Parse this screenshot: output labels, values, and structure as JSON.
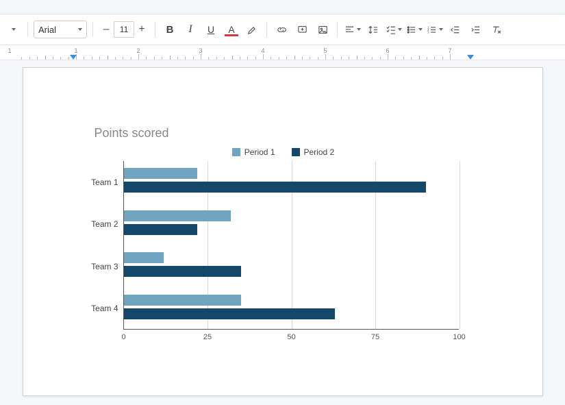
{
  "toolbar": {
    "font_name": "Arial",
    "font_size": "11",
    "btn_dec": "–",
    "btn_inc": "+",
    "bold": "B",
    "italic": "I",
    "underline": "U",
    "textcolor": "A"
  },
  "ruler": {
    "nums": [
      "1",
      "1",
      "2",
      "3",
      "4",
      "5",
      "6",
      "7"
    ]
  },
  "chart_data": {
    "type": "bar",
    "orientation": "horizontal",
    "title": "Points scored",
    "categories": [
      "Team 1",
      "Team 2",
      "Team 3",
      "Team 4"
    ],
    "series": [
      {
        "name": "Period 1",
        "color": "#6fa5bf",
        "values": [
          22,
          32,
          12,
          35
        ]
      },
      {
        "name": "Period 2",
        "color": "#13486a",
        "values": [
          90,
          22,
          35,
          63
        ]
      }
    ],
    "xlim": [
      0,
      100
    ],
    "xticks": [
      0,
      25,
      50,
      75,
      100
    ],
    "ylabel": "",
    "xlabel": ""
  }
}
